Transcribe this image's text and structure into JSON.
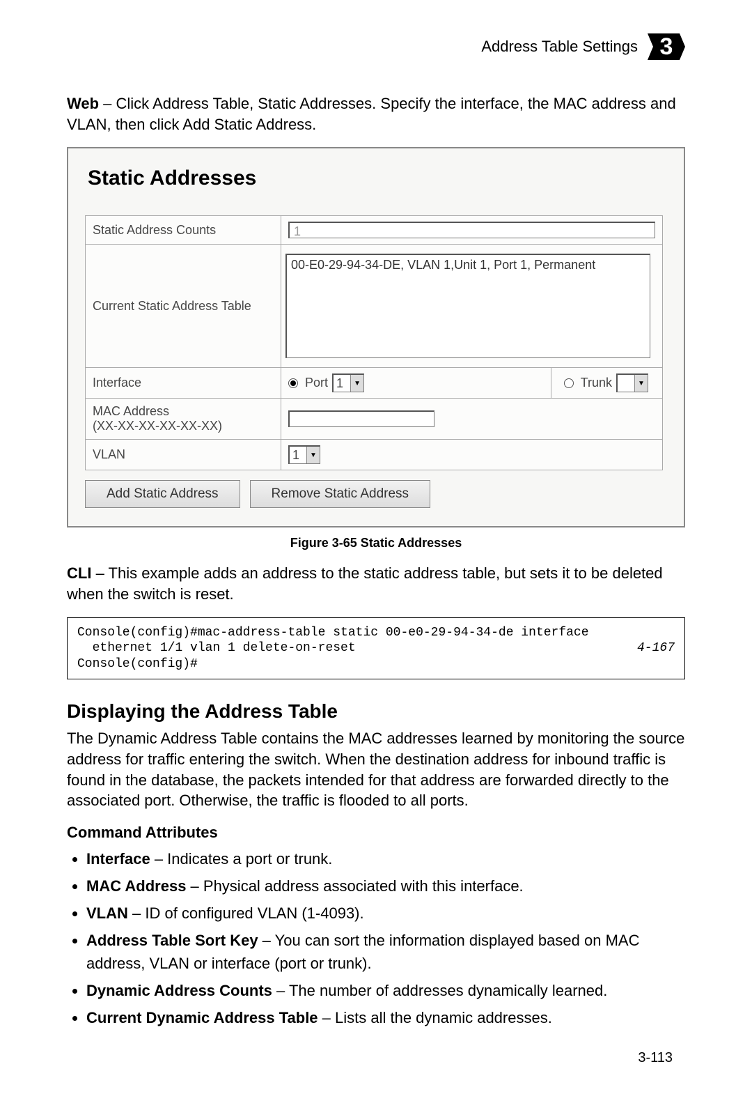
{
  "header": {
    "title": "Address Table Settings",
    "chapter": "3"
  },
  "intro": {
    "lead": "Web",
    "rest": " – Click Address Table, Static Addresses. Specify the interface, the MAC address and VLAN, then click Add Static Address."
  },
  "figure": {
    "title": "Static Addresses",
    "rows": {
      "static_counts_label": "Static Address Counts",
      "static_counts_value": "1",
      "current_table_label": "Current Static Address Table",
      "current_table_entry": "00-E0-29-94-34-DE, VLAN 1,Unit 1, Port 1, Permanent",
      "interface_label": "Interface",
      "port_label": "Port",
      "port_value": "1",
      "trunk_label": "Trunk",
      "trunk_value": "",
      "mac_label_line1": "MAC Address",
      "mac_label_line2": "(XX-XX-XX-XX-XX-XX)",
      "mac_value": "",
      "vlan_label": "VLAN",
      "vlan_value": "1"
    },
    "buttons": {
      "add": "Add Static Address",
      "remove": "Remove Static Address"
    },
    "caption": "Figure 3-65   Static Addresses"
  },
  "cli": {
    "lead": "CLI",
    "rest": " – This example adds an address to the static address table, but sets it to be deleted when the switch is reset.",
    "code_line1": "Console(config)#mac-address-table static 00-e0-29-94-34-de interface",
    "code_line2": "  ethernet 1/1 vlan 1 delete-on-reset",
    "code_ref": "4-167",
    "code_line3": "Console(config)#"
  },
  "section": {
    "heading": "Displaying the Address Table",
    "paragraph": "The Dynamic Address Table contains the MAC addresses learned by monitoring the source address for traffic entering the switch. When the destination address for inbound traffic is found in the database, the packets intended for that address are forwarded directly to the associated port. Otherwise, the traffic is flooded to all ports.",
    "subhead": "Command Attributes",
    "items": [
      {
        "term": "Interface",
        "desc": " – Indicates a port or trunk."
      },
      {
        "term": "MAC Address",
        "desc": " – Physical address associated with this interface."
      },
      {
        "term": "VLAN",
        "desc": " – ID of configured VLAN (1-4093)."
      },
      {
        "term": "Address Table Sort Key",
        "desc": " – You can sort the information displayed based on MAC address, VLAN or interface (port or trunk)."
      },
      {
        "term": "Dynamic Address Counts",
        "desc": " – The number of addresses dynamically learned."
      },
      {
        "term": "Current Dynamic Address Table",
        "desc": " – Lists all the dynamic addresses."
      }
    ]
  },
  "footer": {
    "page": "3-113"
  }
}
